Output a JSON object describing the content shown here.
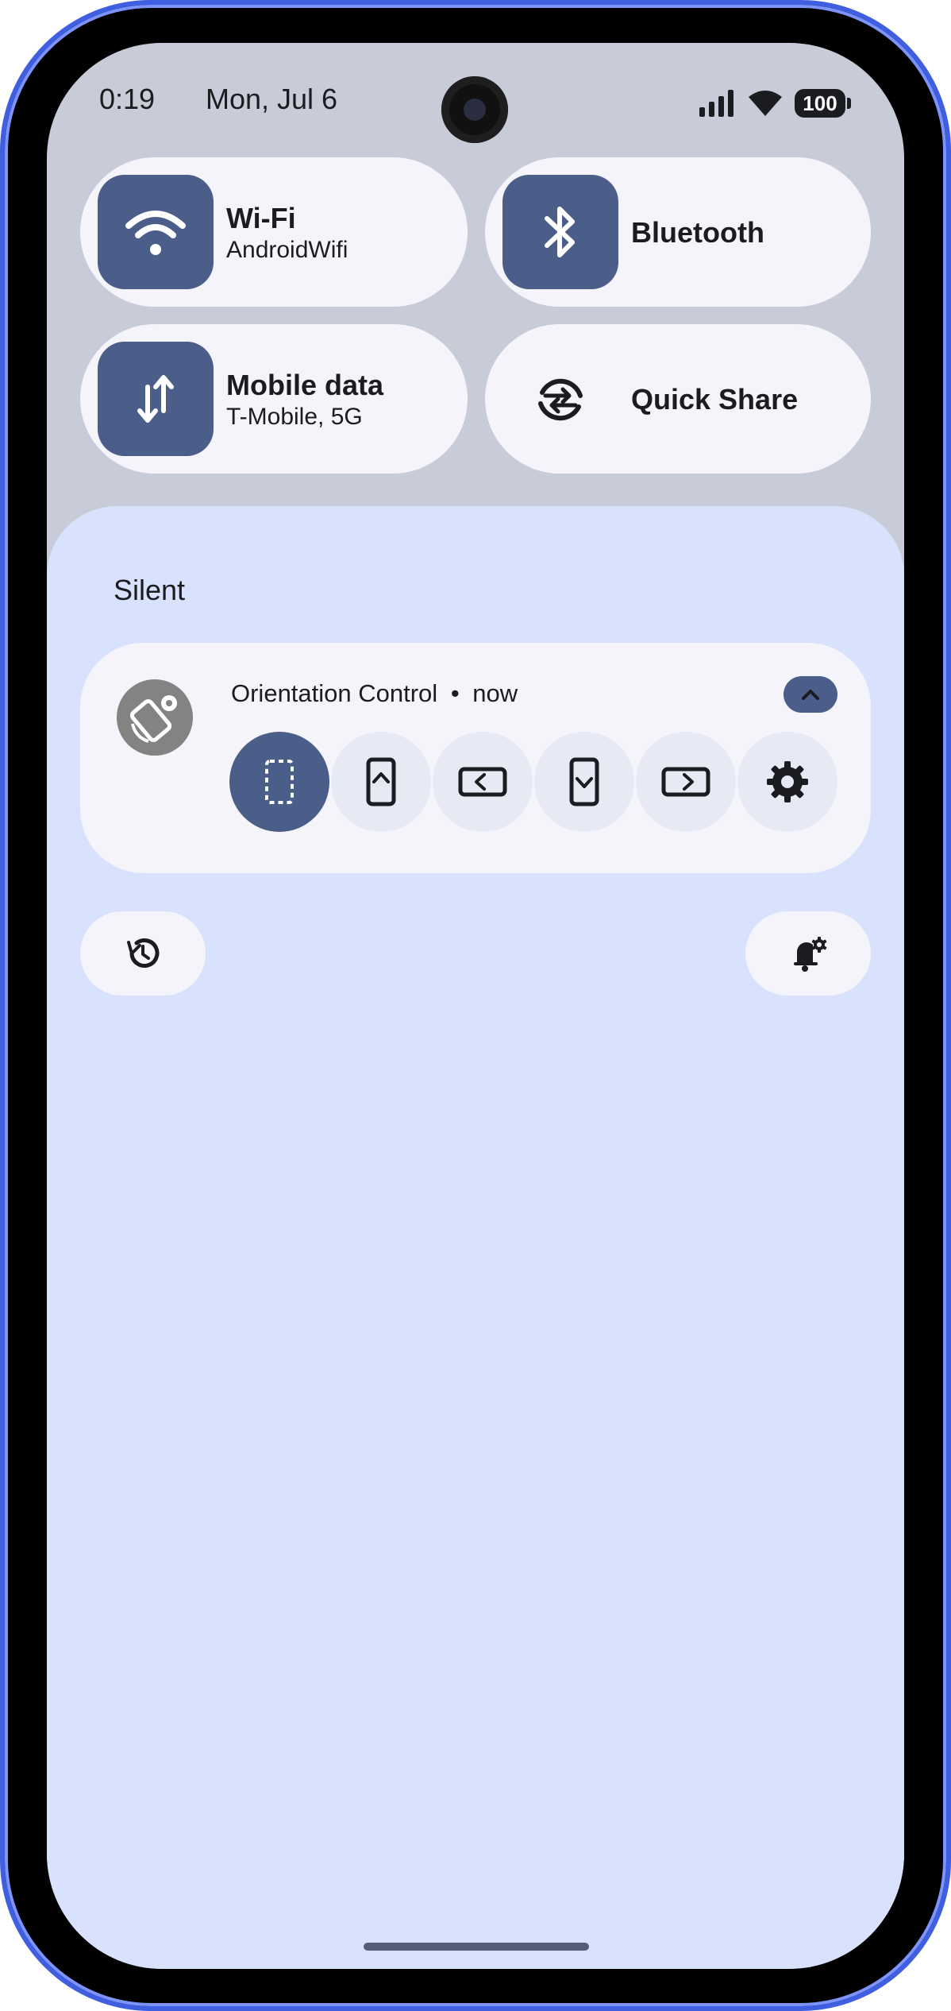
{
  "status_bar": {
    "time": "0:19",
    "date": "Mon, Jul 6",
    "battery": "100",
    "icons": [
      "signal-icon",
      "wifi-icon",
      "battery-icon"
    ]
  },
  "quick_settings": {
    "wifi": {
      "label": "Wi-Fi",
      "sub": "AndroidWifi",
      "icon": "wifi-icon",
      "active": true
    },
    "bluetooth": {
      "label": "Bluetooth",
      "icon": "bluetooth-icon",
      "active": true
    },
    "mobile_data": {
      "label": "Mobile data",
      "sub": "T-Mobile, 5G",
      "icon": "swap-vertical-icon",
      "active": true
    },
    "quick_share": {
      "label": "Quick Share",
      "icon": "quick-share-icon",
      "active": false
    }
  },
  "notifications": {
    "section_label": "Silent",
    "items": [
      {
        "app": "Orientation Control",
        "separator": "•",
        "time": "now",
        "icon": "screen-rotation-settings-icon",
        "actions": [
          {
            "icon": "auto-rotate-icon",
            "active": true
          },
          {
            "icon": "portrait-up-icon",
            "active": false
          },
          {
            "icon": "landscape-left-icon",
            "active": false
          },
          {
            "icon": "portrait-down-icon",
            "active": false
          },
          {
            "icon": "landscape-right-icon",
            "active": false
          },
          {
            "icon": "settings-gear-icon",
            "active": false
          }
        ]
      }
    ],
    "history_button_icon": "history-icon",
    "settings_button_icon": "notification-settings-icon"
  },
  "colors": {
    "accent": "#4b5e8a",
    "shade_background": "#d9e2fc",
    "qs_background": "#c8cbd8",
    "tile_background": "#f4f4fa"
  }
}
